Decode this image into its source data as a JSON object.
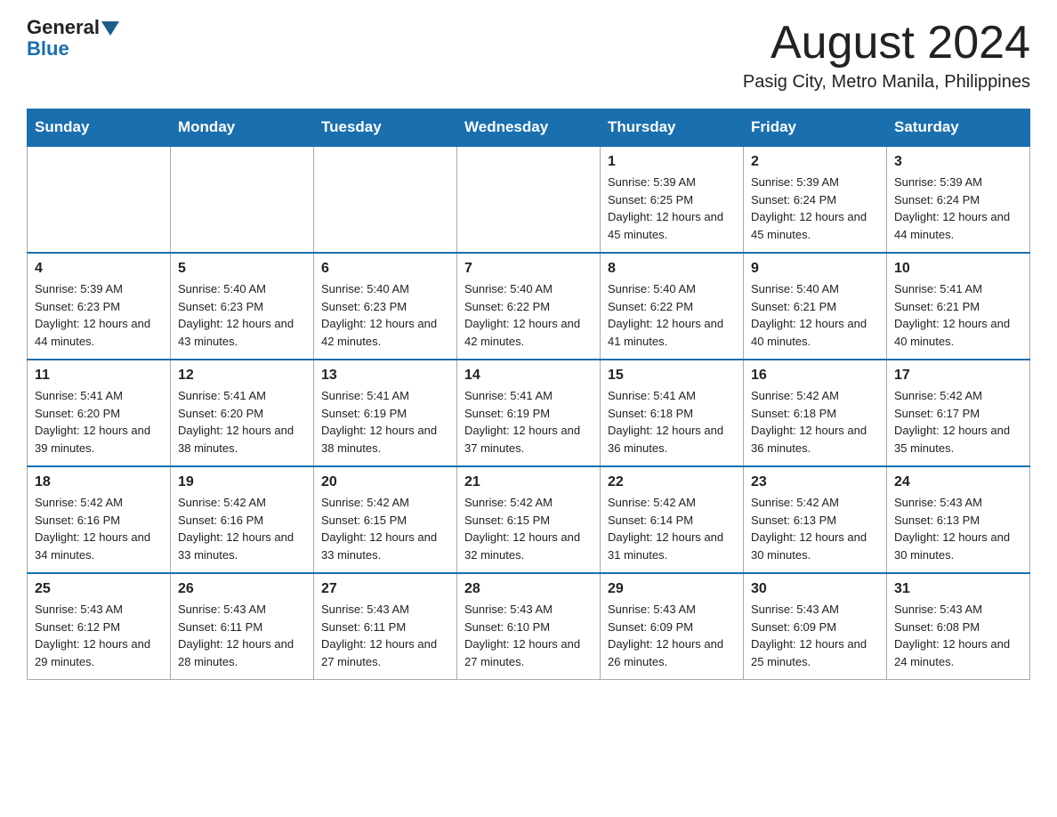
{
  "header": {
    "logo_general": "General",
    "logo_blue": "Blue",
    "month_title": "August 2024",
    "location": "Pasig City, Metro Manila, Philippines"
  },
  "days_of_week": [
    "Sunday",
    "Monday",
    "Tuesday",
    "Wednesday",
    "Thursday",
    "Friday",
    "Saturday"
  ],
  "weeks": [
    [
      {
        "day": "",
        "info": ""
      },
      {
        "day": "",
        "info": ""
      },
      {
        "day": "",
        "info": ""
      },
      {
        "day": "",
        "info": ""
      },
      {
        "day": "1",
        "info": "Sunrise: 5:39 AM\nSunset: 6:25 PM\nDaylight: 12 hours and 45 minutes."
      },
      {
        "day": "2",
        "info": "Sunrise: 5:39 AM\nSunset: 6:24 PM\nDaylight: 12 hours and 45 minutes."
      },
      {
        "day": "3",
        "info": "Sunrise: 5:39 AM\nSunset: 6:24 PM\nDaylight: 12 hours and 44 minutes."
      }
    ],
    [
      {
        "day": "4",
        "info": "Sunrise: 5:39 AM\nSunset: 6:23 PM\nDaylight: 12 hours and 44 minutes."
      },
      {
        "day": "5",
        "info": "Sunrise: 5:40 AM\nSunset: 6:23 PM\nDaylight: 12 hours and 43 minutes."
      },
      {
        "day": "6",
        "info": "Sunrise: 5:40 AM\nSunset: 6:23 PM\nDaylight: 12 hours and 42 minutes."
      },
      {
        "day": "7",
        "info": "Sunrise: 5:40 AM\nSunset: 6:22 PM\nDaylight: 12 hours and 42 minutes."
      },
      {
        "day": "8",
        "info": "Sunrise: 5:40 AM\nSunset: 6:22 PM\nDaylight: 12 hours and 41 minutes."
      },
      {
        "day": "9",
        "info": "Sunrise: 5:40 AM\nSunset: 6:21 PM\nDaylight: 12 hours and 40 minutes."
      },
      {
        "day": "10",
        "info": "Sunrise: 5:41 AM\nSunset: 6:21 PM\nDaylight: 12 hours and 40 minutes."
      }
    ],
    [
      {
        "day": "11",
        "info": "Sunrise: 5:41 AM\nSunset: 6:20 PM\nDaylight: 12 hours and 39 minutes."
      },
      {
        "day": "12",
        "info": "Sunrise: 5:41 AM\nSunset: 6:20 PM\nDaylight: 12 hours and 38 minutes."
      },
      {
        "day": "13",
        "info": "Sunrise: 5:41 AM\nSunset: 6:19 PM\nDaylight: 12 hours and 38 minutes."
      },
      {
        "day": "14",
        "info": "Sunrise: 5:41 AM\nSunset: 6:19 PM\nDaylight: 12 hours and 37 minutes."
      },
      {
        "day": "15",
        "info": "Sunrise: 5:41 AM\nSunset: 6:18 PM\nDaylight: 12 hours and 36 minutes."
      },
      {
        "day": "16",
        "info": "Sunrise: 5:42 AM\nSunset: 6:18 PM\nDaylight: 12 hours and 36 minutes."
      },
      {
        "day": "17",
        "info": "Sunrise: 5:42 AM\nSunset: 6:17 PM\nDaylight: 12 hours and 35 minutes."
      }
    ],
    [
      {
        "day": "18",
        "info": "Sunrise: 5:42 AM\nSunset: 6:16 PM\nDaylight: 12 hours and 34 minutes."
      },
      {
        "day": "19",
        "info": "Sunrise: 5:42 AM\nSunset: 6:16 PM\nDaylight: 12 hours and 33 minutes."
      },
      {
        "day": "20",
        "info": "Sunrise: 5:42 AM\nSunset: 6:15 PM\nDaylight: 12 hours and 33 minutes."
      },
      {
        "day": "21",
        "info": "Sunrise: 5:42 AM\nSunset: 6:15 PM\nDaylight: 12 hours and 32 minutes."
      },
      {
        "day": "22",
        "info": "Sunrise: 5:42 AM\nSunset: 6:14 PM\nDaylight: 12 hours and 31 minutes."
      },
      {
        "day": "23",
        "info": "Sunrise: 5:42 AM\nSunset: 6:13 PM\nDaylight: 12 hours and 30 minutes."
      },
      {
        "day": "24",
        "info": "Sunrise: 5:43 AM\nSunset: 6:13 PM\nDaylight: 12 hours and 30 minutes."
      }
    ],
    [
      {
        "day": "25",
        "info": "Sunrise: 5:43 AM\nSunset: 6:12 PM\nDaylight: 12 hours and 29 minutes."
      },
      {
        "day": "26",
        "info": "Sunrise: 5:43 AM\nSunset: 6:11 PM\nDaylight: 12 hours and 28 minutes."
      },
      {
        "day": "27",
        "info": "Sunrise: 5:43 AM\nSunset: 6:11 PM\nDaylight: 12 hours and 27 minutes."
      },
      {
        "day": "28",
        "info": "Sunrise: 5:43 AM\nSunset: 6:10 PM\nDaylight: 12 hours and 27 minutes."
      },
      {
        "day": "29",
        "info": "Sunrise: 5:43 AM\nSunset: 6:09 PM\nDaylight: 12 hours and 26 minutes."
      },
      {
        "day": "30",
        "info": "Sunrise: 5:43 AM\nSunset: 6:09 PM\nDaylight: 12 hours and 25 minutes."
      },
      {
        "day": "31",
        "info": "Sunrise: 5:43 AM\nSunset: 6:08 PM\nDaylight: 12 hours and 24 minutes."
      }
    ]
  ]
}
